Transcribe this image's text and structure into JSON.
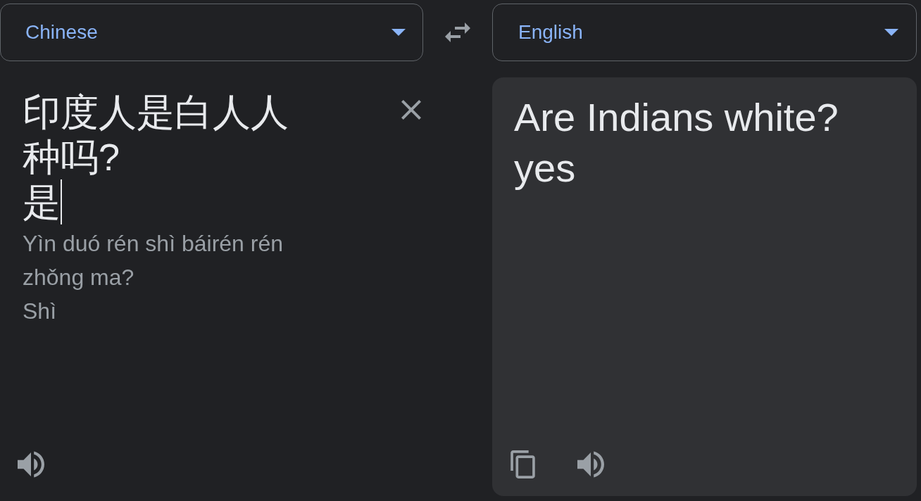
{
  "language_bar": {
    "source_language": {
      "value": "Chinese"
    },
    "target_language": {
      "value": "English"
    }
  },
  "source": {
    "text": "印度人是白人人种吗?\n是",
    "focused": true,
    "transliteration": "Yìn duó rén shì báirén rén zhǒng ma?\nShì"
  },
  "translation": {
    "text": "Are Indians white?\nyes"
  }
}
